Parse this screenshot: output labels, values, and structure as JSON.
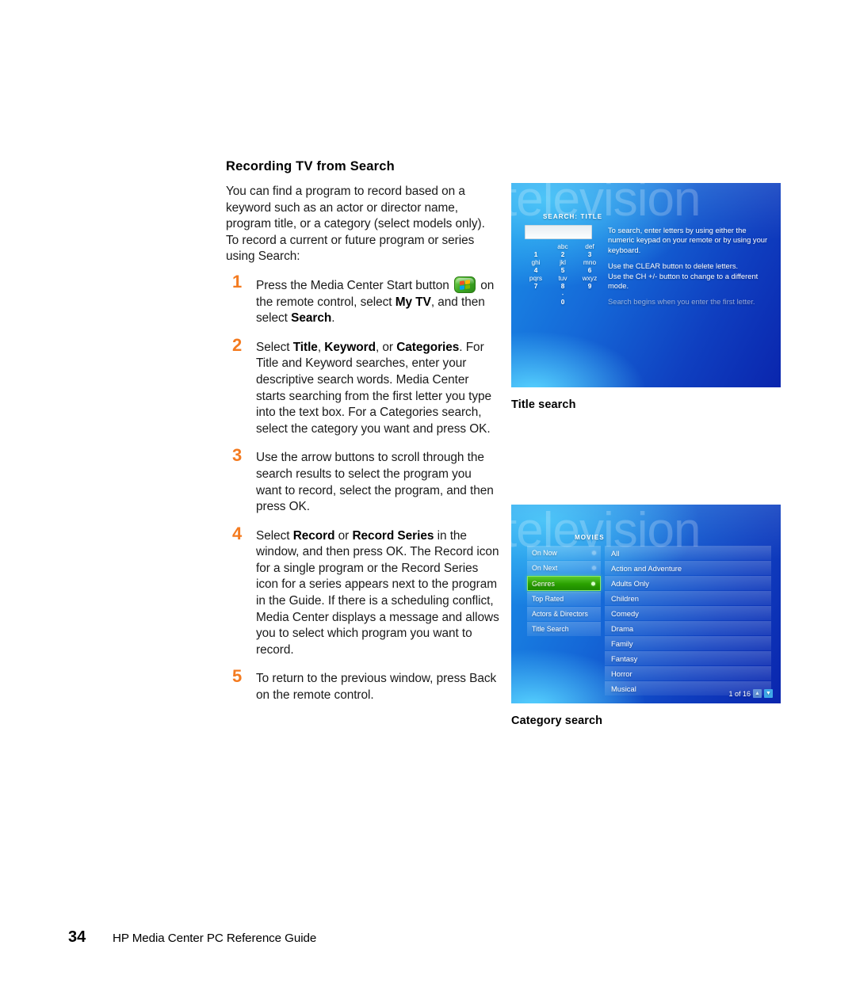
{
  "page": {
    "section_title": "Recording TV from Search",
    "intro": "You can find a program to record based on a keyword such as an actor or director name, program title, or a category (select models only). To record a current or future program or series using Search:"
  },
  "steps": [
    {
      "num": "1",
      "parts": [
        {
          "t": "Press the Media Center Start button ",
          "b": false
        },
        {
          "t": "mediacenter-start-icon",
          "b": false,
          "icon": true
        },
        {
          "t": " on the remote control, select ",
          "b": false
        },
        {
          "t": "My TV",
          "b": true
        },
        {
          "t": ", and then select ",
          "b": false
        },
        {
          "t": "Search",
          "b": true
        },
        {
          "t": ".",
          "b": false
        }
      ]
    },
    {
      "num": "2",
      "parts": [
        {
          "t": "Select ",
          "b": false
        },
        {
          "t": "Title",
          "b": true
        },
        {
          "t": ", ",
          "b": false
        },
        {
          "t": "Keyword",
          "b": true
        },
        {
          "t": ", or ",
          "b": false
        },
        {
          "t": "Categories",
          "b": true
        },
        {
          "t": ". For Title and Keyword searches, enter your descriptive search words. Media Center starts searching from the first letter you type into the text box. For a Categories search, select the category you want and press OK.",
          "b": false
        }
      ]
    },
    {
      "num": "3",
      "parts": [
        {
          "t": "Use the arrow buttons to scroll through the search results to select the program you want to record, select the program, and then press OK.",
          "b": false
        }
      ]
    },
    {
      "num": "4",
      "parts": [
        {
          "t": "Select ",
          "b": false
        },
        {
          "t": "Record",
          "b": true
        },
        {
          "t": " or ",
          "b": false
        },
        {
          "t": "Record Series",
          "b": true
        },
        {
          "t": " in the window, and then press OK. The Record icon for a single program or the Record Series icon for a series appears next to the program in the Guide. If there is a scheduling conflict, Media Center displays a message and allows you to select which program you want to record.",
          "b": false
        }
      ]
    },
    {
      "num": "5",
      "parts": [
        {
          "t": "To return to the previous window, press Back on the remote control.",
          "b": false
        }
      ]
    }
  ],
  "figures": {
    "title_search": {
      "caption": "Title search",
      "watermark": "television",
      "header": "SEARCH: TITLE",
      "input_value": "",
      "keypad": [
        {
          "letters": "",
          "digit": "1"
        },
        {
          "letters": "abc",
          "digit": "2"
        },
        {
          "letters": "def",
          "digit": "3"
        },
        {
          "letters": "ghi",
          "digit": "4"
        },
        {
          "letters": "jkl",
          "digit": "5"
        },
        {
          "letters": "mno",
          "digit": "6"
        },
        {
          "letters": "pqrs",
          "digit": "7"
        },
        {
          "letters": "tuv",
          "digit": "8"
        },
        {
          "letters": "wxyz",
          "digit": "9"
        },
        {
          "letters": "",
          "digit": ""
        },
        {
          "letters": "-",
          "digit": "0"
        },
        {
          "letters": "",
          "digit": ""
        }
      ],
      "instructions": [
        "To search, enter letters by using either the numeric keypad on your remote or by using your keyboard.",
        "Use the CLEAR button to delete letters.",
        "Use the CH +/- button to change to a different mode."
      ],
      "instruction_dim": "Search begins when you enter the first letter."
    },
    "category_search": {
      "caption": "Category search",
      "watermark": "television",
      "header": "MOVIES",
      "left_items": [
        {
          "label": "On Now",
          "selected": false,
          "dot": true
        },
        {
          "label": "On Next",
          "selected": false,
          "dot": true
        },
        {
          "label": "Genres",
          "selected": true,
          "dot": true
        },
        {
          "label": "Top Rated",
          "selected": false,
          "dot": false
        },
        {
          "label": "Actors & Directors",
          "selected": false,
          "dot": false
        },
        {
          "label": "Title Search",
          "selected": false,
          "dot": false
        }
      ],
      "right_items": [
        "All",
        "Action and Adventure",
        "Adults Only",
        "Children",
        "Comedy",
        "Drama",
        "Family",
        "Fantasy",
        "Horror",
        "Musical"
      ],
      "pager_label": "1 of 16",
      "pager_up_icon": "chevron-up-icon",
      "pager_down_icon": "chevron-down-icon"
    }
  },
  "footer": {
    "page_number": "34",
    "guide_title": "HP Media Center PC Reference Guide"
  },
  "colors": {
    "step_number": "#F47B20",
    "selected_item": "#2aa000",
    "screen_blue": "#1569d8"
  }
}
